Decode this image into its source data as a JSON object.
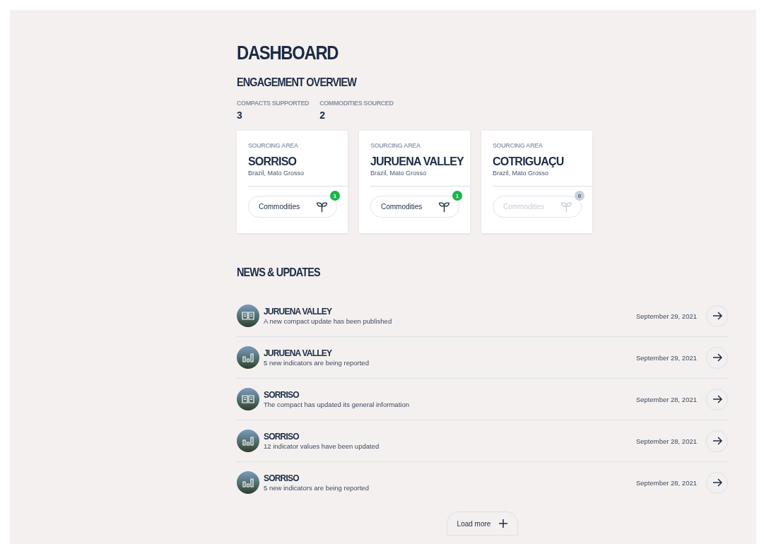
{
  "page": {
    "title": "DASHBOARD"
  },
  "engagement": {
    "title": "ENGAGEMENT OVERVIEW",
    "stats": [
      {
        "label": "COMPACTS SUPPORTED",
        "value": "3"
      },
      {
        "label": "COMMODITIES SOURCED",
        "value": "2"
      }
    ]
  },
  "sourcing_areas": [
    {
      "label": "SOURCING AREA",
      "name": "SORRISO",
      "location": "Brazil, Mato Grosso",
      "button": "Commodities",
      "count": "1",
      "disabled": false
    },
    {
      "label": "SOURCING AREA",
      "name": "JURUENA VALLEY",
      "location": "Brazil, Mato Grosso",
      "button": "Commodities",
      "count": "1",
      "disabled": false
    },
    {
      "label": "SOURCING AREA",
      "name": "COTRIGUAÇU",
      "location": "Brazil, Mato Grosso",
      "button": "Commodities",
      "count": "0",
      "disabled": true
    }
  ],
  "news": {
    "title": "NEWS & UPDATES",
    "items": [
      {
        "kind": "book",
        "title": "JURUENA VALLEY",
        "text": "A new compact update has been published",
        "date": "September 29, 2021"
      },
      {
        "kind": "chart",
        "title": "JURUENA VALLEY",
        "text": "5 new indicators are being reported",
        "date": "September 29, 2021"
      },
      {
        "kind": "book",
        "title": "SORRISO",
        "text": "The compact has updated its general information",
        "date": "September 28, 2021"
      },
      {
        "kind": "chart",
        "title": "SORRISO",
        "text": "12 indicator values have been updated",
        "date": "September 28, 2021"
      },
      {
        "kind": "chart",
        "title": "SORRISO",
        "text": "5 new indicators are being reported",
        "date": "September 28, 2021"
      }
    ],
    "load_more": "Load more"
  }
}
